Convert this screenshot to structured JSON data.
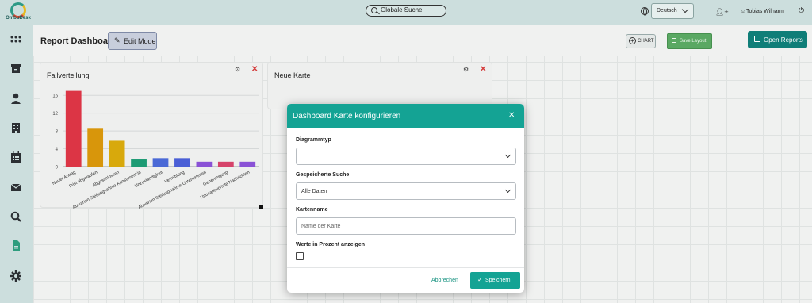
{
  "app": {
    "logo_text": "OmbuDesk"
  },
  "topbar": {
    "search_placeholder": "Globale Suche",
    "language": "Deutsch",
    "user_name": "Tobias Wilharm"
  },
  "sidebar": {
    "items": [
      {
        "icon": "grid-icon"
      },
      {
        "icon": "archive-icon"
      },
      {
        "icon": "user-icon"
      },
      {
        "icon": "building-icon"
      },
      {
        "icon": "calendar-icon"
      },
      {
        "icon": "mail-icon"
      },
      {
        "icon": "search-icon"
      },
      {
        "icon": "document-icon",
        "active": true
      },
      {
        "icon": "gear-icon"
      }
    ]
  },
  "header": {
    "title": "Report Dashboard",
    "edit_mode": "Edit Mode",
    "chart_button": "CHART",
    "save_layout": "Save Layout",
    "open_reports": "Open Reports"
  },
  "cards": [
    {
      "title": "Fallverteilung"
    },
    {
      "title": "Neue Karte"
    }
  ],
  "chart_data": {
    "type": "bar",
    "title": "Fallverteilung",
    "categories": [
      "Neuer Antrag",
      "Frist abgelaufen",
      "Abgeschlossen",
      "Abwarten Stellungnahme Konsument:in",
      "Unzuständigkeit",
      "Vermittlung",
      "Abwarten Stellungnahme Unternehmen",
      "Genehmigung",
      "Unbeantwortete Nachrichten"
    ],
    "values": [
      17,
      8.5,
      5.8,
      1.6,
      1.9,
      1.9,
      1.1,
      1.1,
      1.1
    ],
    "colors": [
      "#dc3545",
      "#d8960b",
      "#d8a90c",
      "#1d9b74",
      "#4a69d6",
      "#4a5fd6",
      "#8a52d6",
      "#d6436a",
      "#8a52d6"
    ],
    "yticks": [
      0,
      4,
      8,
      12,
      16
    ],
    "ylim": [
      0,
      18
    ],
    "grid": true,
    "legend": "none"
  },
  "modal": {
    "title": "Dashboard Karte konfigurieren",
    "chart_type_label": "Diagrammtyp",
    "chart_type_value": "",
    "saved_search_label": "Gespeicherte Suche",
    "saved_search_value": "Alle Daten",
    "card_name_label": "Kartenname",
    "card_name_placeholder": "Name der Karte",
    "percent_label": "Werte in Prozent anzeigen",
    "percent_checked": false,
    "cancel": "Abbrechen",
    "save": "Speichern"
  }
}
